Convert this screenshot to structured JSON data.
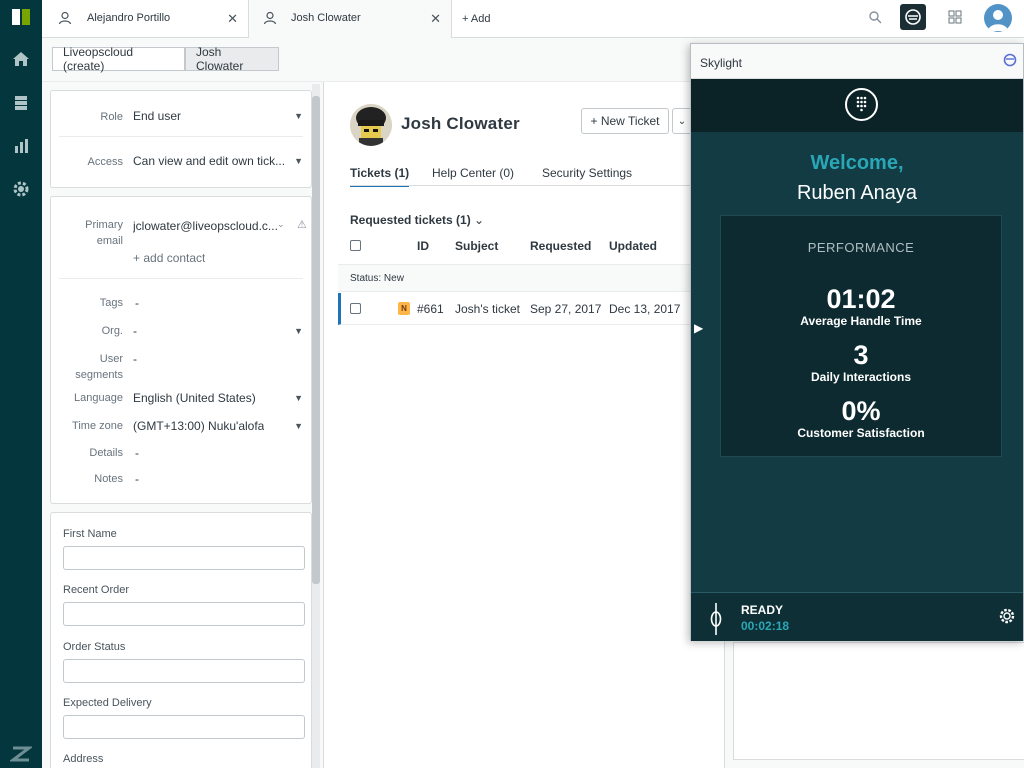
{
  "tabs": [
    {
      "label": "Alejandro Portillo"
    },
    {
      "label": "Josh Clowater"
    }
  ],
  "add_tab": "+ Add",
  "breadcrumb": [
    "Liveopscloud (create)",
    "Josh Clowater"
  ],
  "user_fields": {
    "role_label": "Role",
    "role_value": "End user",
    "access_label": "Access",
    "access_value": "Can view and edit own tick...",
    "email_label_1": "Primary",
    "email_label_2": "email",
    "email_value": "jclowater@liveopscloud.c...",
    "add_contact": "+ add contact",
    "tags_label": "Tags",
    "tags_value": "-",
    "org_label": "Org.",
    "org_value": "-",
    "segments_label_1": "User",
    "segments_label_2": "segments",
    "segments_value": "-",
    "language_label": "Language",
    "language_value": "English (United States)",
    "timezone_label": "Time zone",
    "timezone_value": "(GMT+13:00) Nuku'alofa",
    "details_label": "Details",
    "details_value": "-",
    "notes_label": "Notes",
    "notes_value": "-"
  },
  "custom_fields": [
    "First Name",
    "Recent Order",
    "Order Status",
    "Expected Delivery",
    "Address"
  ],
  "profile": {
    "name": "Josh Clowater",
    "new_ticket": "+ New Ticket",
    "tabs": [
      "Tickets (1)",
      "Help Center (0)",
      "Security Settings"
    ]
  },
  "tickets": {
    "title": "Requested tickets (1)",
    "headers": [
      "ID",
      "Subject",
      "Requested",
      "Updated"
    ],
    "group": "Status: New",
    "rows": [
      {
        "status": "N",
        "id": "#661",
        "subject": "Josh's ticket",
        "requested": "Sep 27, 2017",
        "updated": "Dec 13, 2017"
      }
    ]
  },
  "skylight": {
    "title": "Skylight",
    "welcome": "Welcome,",
    "agent": "Ruben Anaya",
    "performance_title": "PERFORMANCE",
    "metrics": [
      {
        "value": "01:02",
        "label": "Average Handle Time"
      },
      {
        "value": "3",
        "label": "Daily Interactions"
      },
      {
        "value": "0%",
        "label": "Customer Satisfaction"
      }
    ],
    "status": "READY",
    "timer": "00:02:18"
  },
  "colors": {
    "rail": "#03363d",
    "accent": "#1f73b7",
    "widget_bg": "#123b44",
    "welcome": "#2aa7b6",
    "badge_new": "#ffb648"
  }
}
